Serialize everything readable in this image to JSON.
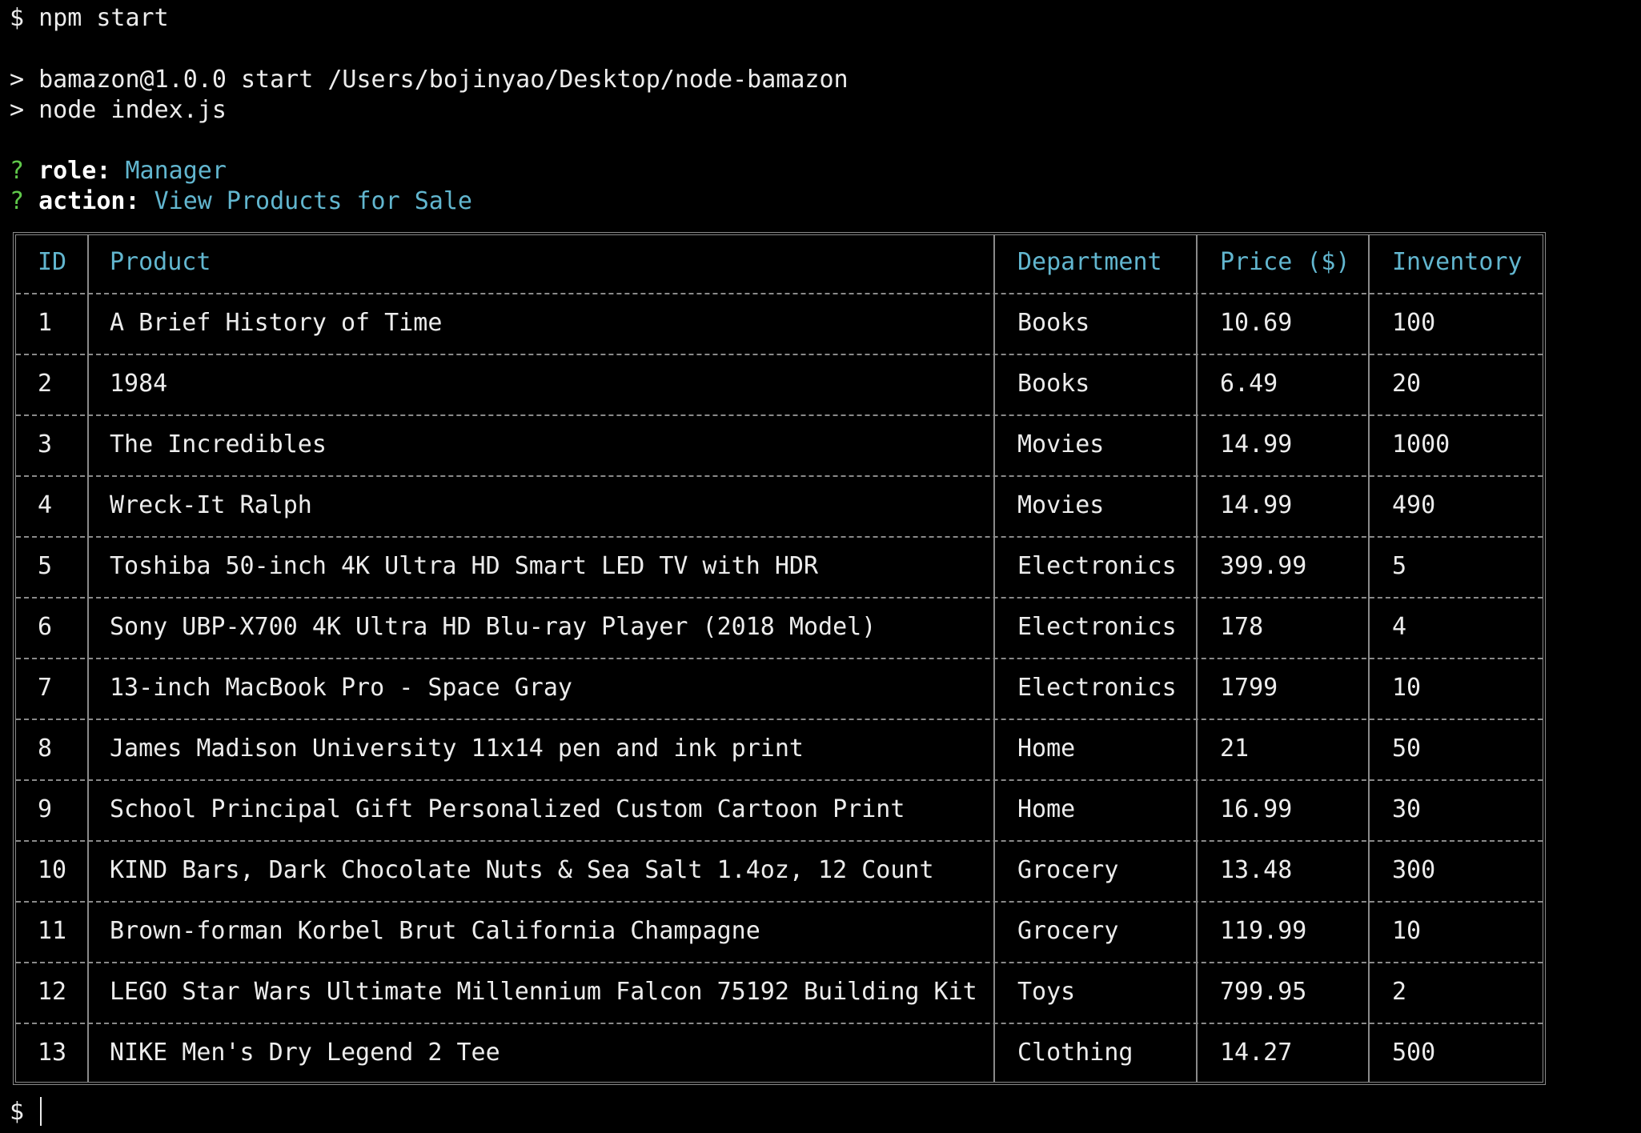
{
  "terminal": {
    "lines": {
      "cmd": "$ npm start",
      "script_info": "> bamazon@1.0.0 start /Users/bojinyao/Desktop/node-bamazon",
      "script_cmd": "> node index.js"
    },
    "prompts": [
      {
        "mark": "?",
        "key": "role:",
        "value": "Manager"
      },
      {
        "mark": "?",
        "key": "action:",
        "value": "View Products for Sale"
      }
    ],
    "final_prompt": "$"
  },
  "table": {
    "headers": [
      "ID",
      "Product",
      "Department",
      "Price ($)",
      "Inventory"
    ],
    "rows": [
      [
        "1",
        "A Brief History of Time",
        "Books",
        "10.69",
        "100"
      ],
      [
        "2",
        "1984",
        "Books",
        "6.49",
        "20"
      ],
      [
        "3",
        "The Incredibles",
        "Movies",
        "14.99",
        "1000"
      ],
      [
        "4",
        "Wreck-It Ralph",
        "Movies",
        "14.99",
        "490"
      ],
      [
        "5",
        "Toshiba 50-inch 4K Ultra HD Smart LED TV with HDR",
        "Electronics",
        "399.99",
        "5"
      ],
      [
        "6",
        "Sony UBP-X700 4K Ultra HD Blu-ray Player (2018 Model)",
        "Electronics",
        "178",
        "4"
      ],
      [
        "7",
        "13-inch MacBook Pro - Space Gray",
        "Electronics",
        "1799",
        "10"
      ],
      [
        "8",
        "James Madison University 11x14 pen and ink print",
        "Home",
        "21",
        "50"
      ],
      [
        "9",
        "School Principal Gift Personalized Custom Cartoon Print",
        "Home",
        "16.99",
        "30"
      ],
      [
        "10",
        "KIND Bars, Dark Chocolate Nuts & Sea Salt 1.4oz, 12 Count",
        "Grocery",
        "13.48",
        "300"
      ],
      [
        "11",
        "Brown-forman Korbel Brut California Champagne",
        "Grocery",
        "119.99",
        "10"
      ],
      [
        "12",
        "LEGO Star Wars Ultimate Millennium Falcon 75192 Building Kit",
        "Toys",
        "799.95",
        "2"
      ],
      [
        "13",
        "NIKE Men's Dry Legend 2 Tee",
        "Clothing",
        "14.27",
        "500"
      ]
    ]
  },
  "colors": {
    "background": "#000000",
    "text": "#ececec",
    "prompt_mark": "#5fc84a",
    "answer": "#62b6cf",
    "header": "#62b6cf",
    "border": "#8a8a8a"
  }
}
